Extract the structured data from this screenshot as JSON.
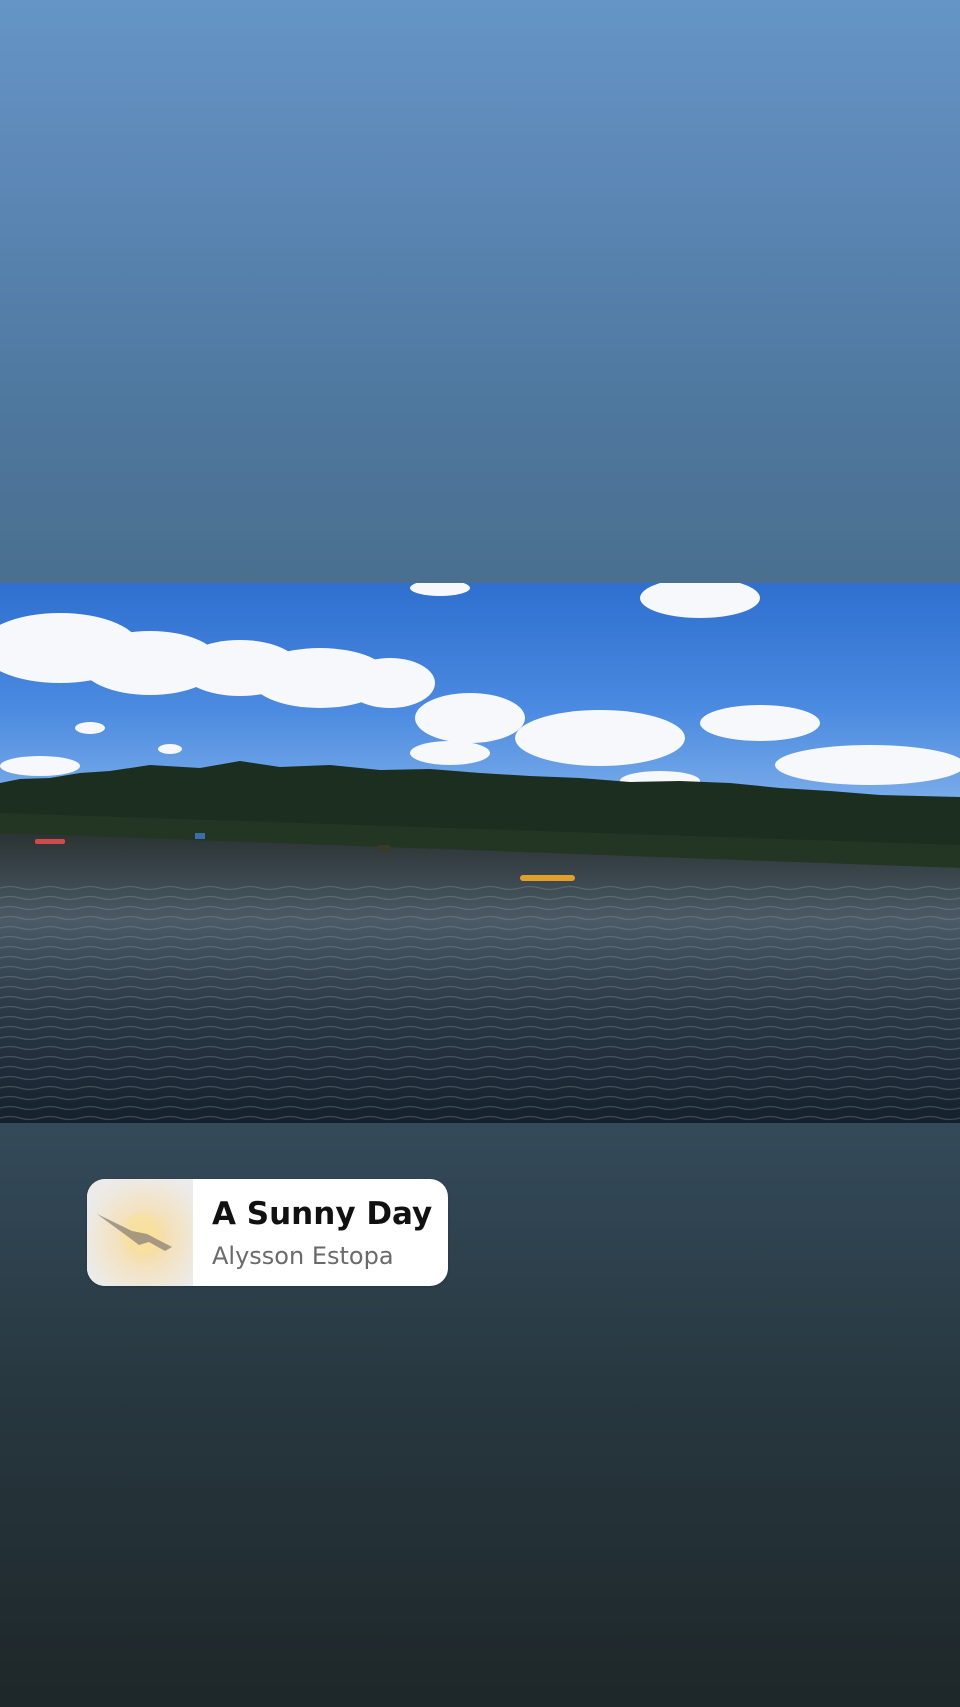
{
  "music_sticker": {
    "title": "A Sunny Day",
    "artist": "Alysson Estopa",
    "album_art_icon": "bird-over-sun-icon"
  },
  "media": {
    "photo_icon": "lake-landscape-photo"
  },
  "colors": {
    "background_top": "#6595c6",
    "background_bottom": "#1e2729",
    "sticker_background": "#ffffff",
    "title_color": "#111111",
    "artist_color": "#6a6a6a"
  }
}
